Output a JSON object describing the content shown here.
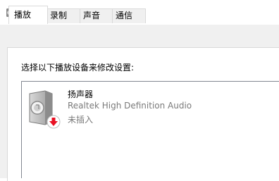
{
  "window": {
    "title": "声音",
    "icon": "speaker-icon"
  },
  "tabs": [
    {
      "label": "播放",
      "active": true
    },
    {
      "label": "录制",
      "active": false
    },
    {
      "label": "声音",
      "active": false
    },
    {
      "label": "通信",
      "active": false
    }
  ],
  "playback": {
    "instruction": "选择以下播放设备来修改设置:",
    "devices": [
      {
        "name": "扬声器",
        "driver": "Realtek High Definition Audio",
        "status": "未插入",
        "icon": "speaker-device-icon",
        "badge": "unplugged-down-arrow-icon",
        "badge_color": "#e81123"
      }
    ]
  }
}
